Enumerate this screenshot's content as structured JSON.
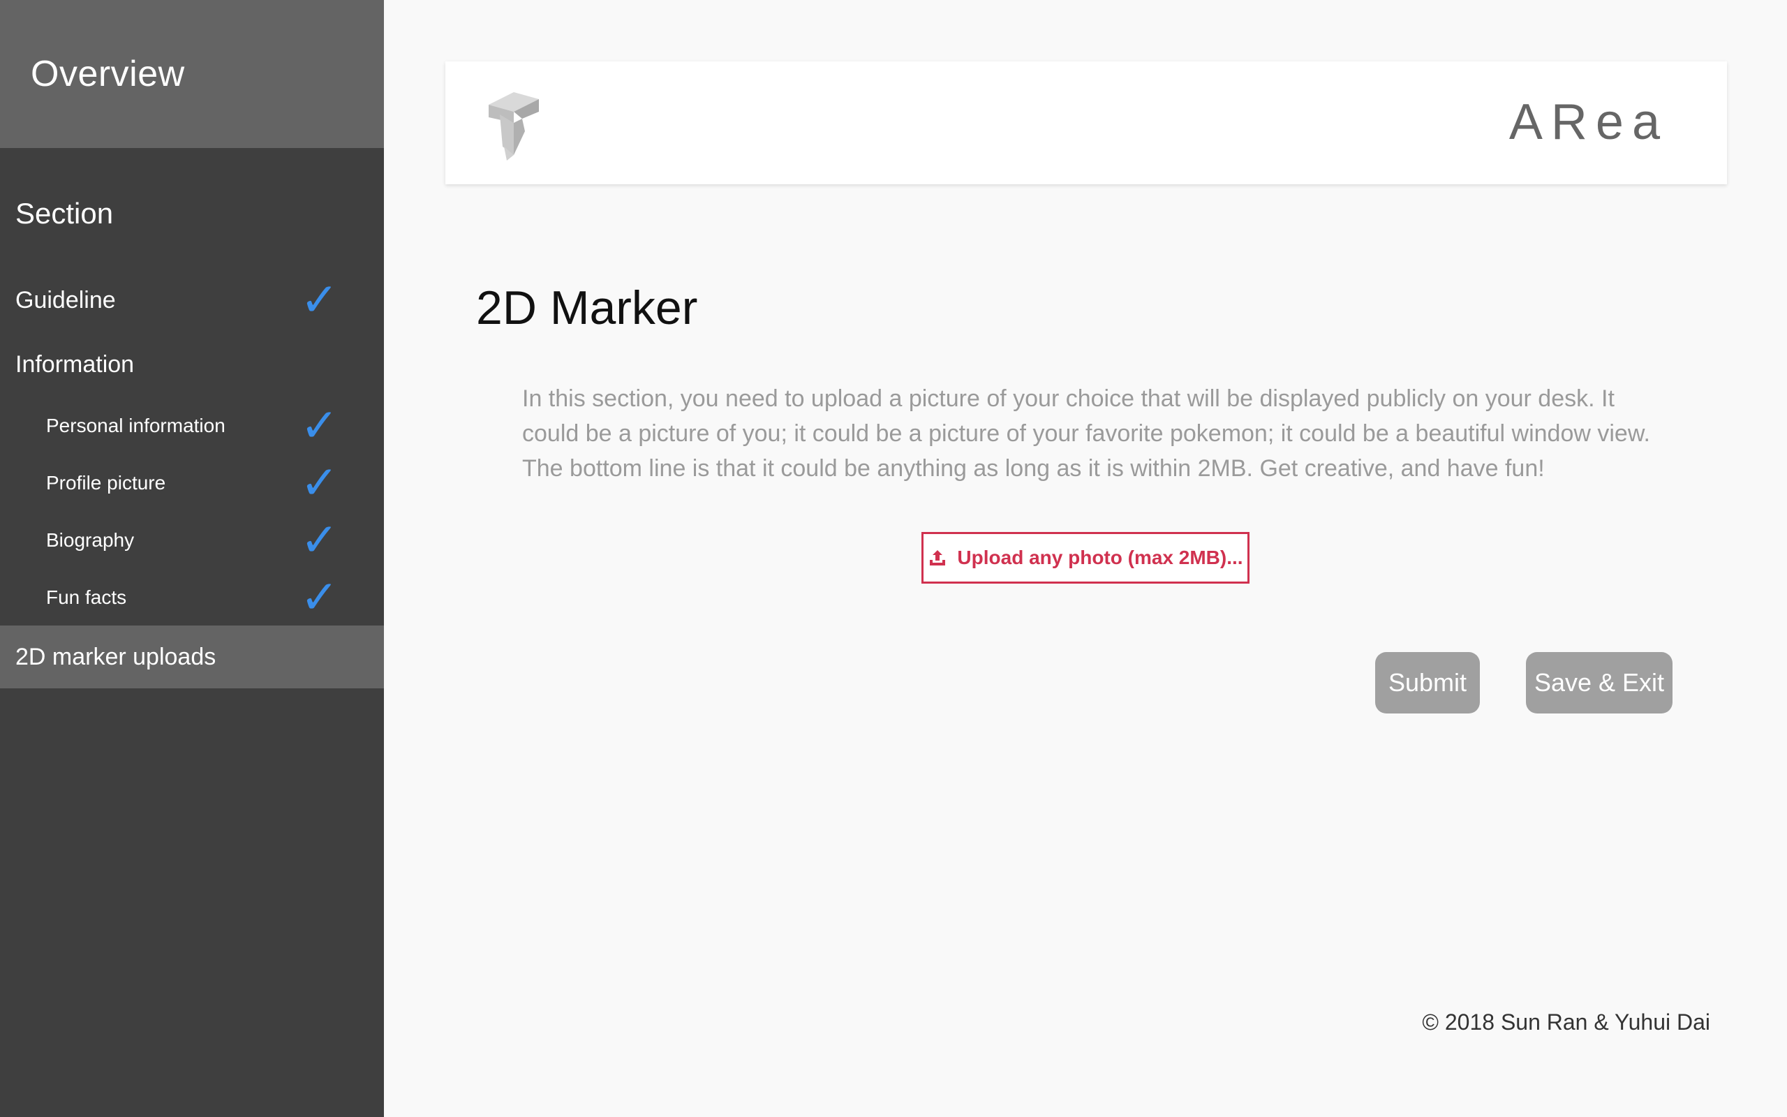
{
  "sidebar": {
    "title": "Overview",
    "section_heading": "Section",
    "items": [
      {
        "label": "Guideline",
        "checked": true
      },
      {
        "label": "Information",
        "checked": false
      },
      {
        "label": "Personal information",
        "checked": true
      },
      {
        "label": "Profile picture",
        "checked": true
      },
      {
        "label": "Biography",
        "checked": true
      },
      {
        "label": "Fun facts",
        "checked": true
      },
      {
        "label": "2D marker uploads",
        "checked": false,
        "active": true
      }
    ],
    "check_glyph": "✓",
    "check_color": "#3a8eea"
  },
  "header": {
    "brand": "ARea",
    "logo_icon": "t-cube-logo-icon"
  },
  "main": {
    "title": "2D Marker",
    "description": "In this section, you need to upload a picture of your choice that will be displayed publicly on your desk. It could be a picture of you; it could be a picture of your favorite pokemon; it could be a beautiful window view. The bottom line is that it could be anything as long as it is within 2MB. Get creative, and have fun!",
    "upload_label": "Upload any photo (max 2MB)...",
    "upload_icon": "upload-icon",
    "submit_label": "Submit",
    "save_exit_label": "Save & Exit"
  },
  "footer": {
    "copyright": "© 2018 Sun Ran & Yuhui Dai"
  },
  "colors": {
    "sidebar_bg": "#3f3f3f",
    "sidebar_highlight": "#646464",
    "accent_red": "#d0314f",
    "button_gray": "#a0a0a0"
  }
}
